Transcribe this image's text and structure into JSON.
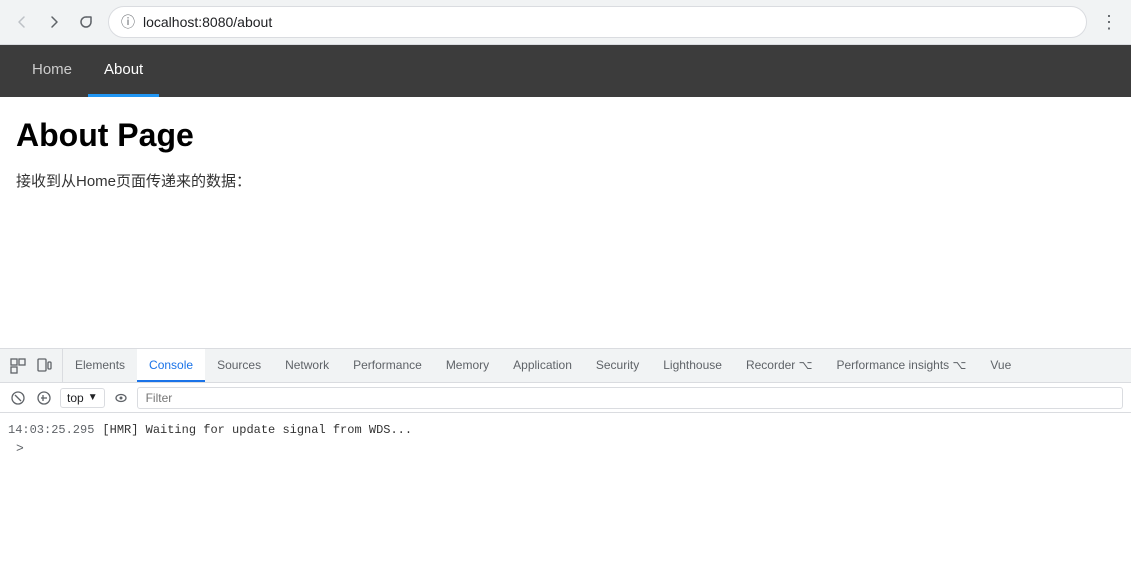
{
  "browser": {
    "url": "localhost:8080/about",
    "back_button": "←",
    "forward_button": "→",
    "reload_button": "↻",
    "menu_dots": "⋮"
  },
  "navbar": {
    "links": [
      {
        "label": "Home",
        "active": false
      },
      {
        "label": "About",
        "active": true
      }
    ]
  },
  "page": {
    "title": "About Page",
    "subtitle": "接收到从Home页面传递来的数据："
  },
  "devtools": {
    "tabs": [
      {
        "label": "Elements",
        "active": false
      },
      {
        "label": "Console",
        "active": true
      },
      {
        "label": "Sources",
        "active": false
      },
      {
        "label": "Network",
        "active": false
      },
      {
        "label": "Performance",
        "active": false
      },
      {
        "label": "Memory",
        "active": false
      },
      {
        "label": "Application",
        "active": false
      },
      {
        "label": "Security",
        "active": false
      },
      {
        "label": "Lighthouse",
        "active": false
      },
      {
        "label": "Recorder ⌥",
        "active": false
      },
      {
        "label": "Performance insights ⌥",
        "active": false
      },
      {
        "label": "Vue",
        "active": false
      }
    ],
    "toolbar": {
      "context": "top",
      "filter_placeholder": "Filter"
    },
    "console_lines": [
      {
        "timestamp": "14:03:25.295",
        "message": "[HMR] Waiting for update signal from WDS..."
      }
    ],
    "prompt_symbol": ">"
  }
}
